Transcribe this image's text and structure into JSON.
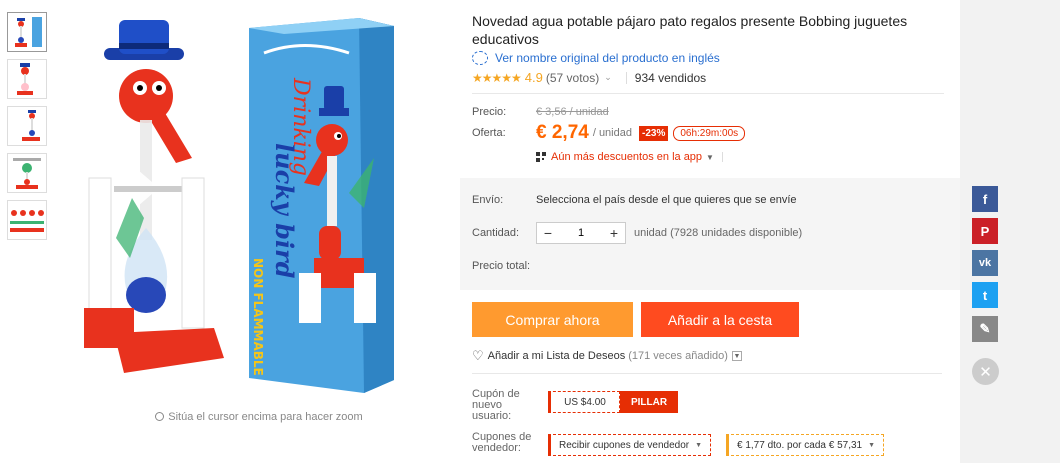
{
  "product": {
    "title": "Novedad agua potable pájaro pato regalos presente Bobbing juguetes educativos",
    "translate_link": "Ver nombre original del producto en inglés",
    "rating_score": "4.9",
    "votes": "(57 votos)",
    "sold": "934 vendidos",
    "rating_stars": 5
  },
  "images": {
    "box_text_1": "Drinking",
    "box_text_2": "lucky bird",
    "box_text_3": "NON FLAMMABLE",
    "zoom_hint": "Sitúa el cursor encima para hacer zoom",
    "thumbnail_count": 5
  },
  "price": {
    "label_price": "Precio:",
    "old_price": "€ 3,56 / unidad",
    "label_offer": "Oferta:",
    "offer_price": "€ 2,74",
    "unit": "/ unidad",
    "discount": "-23%",
    "timer": "06h:29m:00s",
    "app_discount": "Aún más descuentos en la app"
  },
  "shipping": {
    "label_ship": "Envío:",
    "ship_text": "Selecciona el país desde el que quieres que se envíe",
    "label_qty": "Cantidad:",
    "qty_value": "1",
    "availability": "unidad (7928 unidades disponible)",
    "label_total": "Precio total:"
  },
  "actions": {
    "buy_now": "Comprar ahora",
    "add_cart": "Añadir a la cesta",
    "wishlist": "Añadir a mi Lista de Deseos",
    "wishlist_count": "(171 veces añadido)"
  },
  "coupons": {
    "new_user_label": "Cupón de nuevo usuario:",
    "new_user_value": "US $4.00",
    "grab": "PILLAR",
    "seller_label": "Cupones de vendedor:",
    "seller_select": "Recibir cupones de vendedor",
    "seller_offer": "€ 1,77 dto. por cada € 57,31"
  },
  "colors": {
    "offer": "#ff6600",
    "buy": "#ff9a2f",
    "cart": "#ff4b1f",
    "accent_red": "#e62e04",
    "facebook": "#3b5998",
    "pinterest": "#cb2027",
    "vk": "#4c75a3",
    "twitter": "#1da1f2"
  },
  "social_icons": [
    "facebook-icon",
    "pinterest-icon",
    "vk-icon",
    "twitter-icon",
    "edit-icon",
    "close-icon"
  ]
}
